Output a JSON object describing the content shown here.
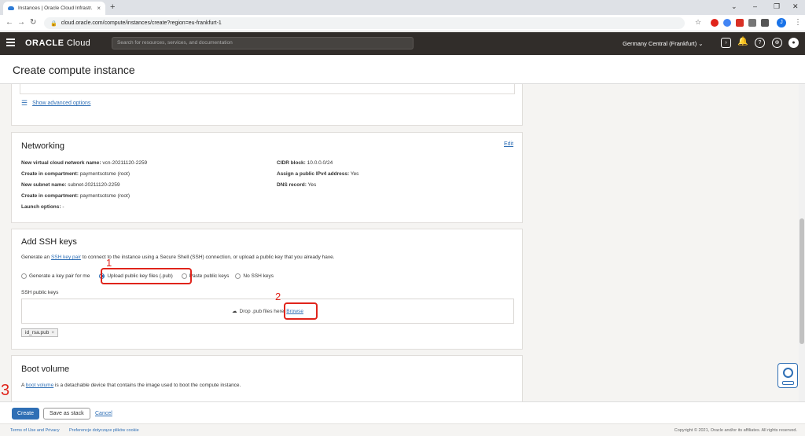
{
  "browser": {
    "tab_title": "Instances | Oracle Cloud Infrastr...",
    "url": "cloud.oracle.com/compute/instances/create?region=eu-frankfurt-1",
    "profile_initial": "J"
  },
  "header": {
    "logo_oracle": "ORACLE",
    "logo_cloud": "Cloud",
    "search_placeholder": "Search for resources, services, and documentation",
    "region": "Germany Central (Frankfurt)"
  },
  "page": {
    "title": "Create compute instance"
  },
  "advanced": {
    "label": "Show advanced options"
  },
  "networking": {
    "title": "Networking",
    "edit": "Edit",
    "left": [
      {
        "k": "New virtual cloud network name:",
        "v": "vcn-20211120-2259"
      },
      {
        "k": "Create in compartment:",
        "v": "paymentsotsme (root)"
      },
      {
        "k": "New subnet name:",
        "v": "subnet-20211120-2259"
      },
      {
        "k": "Create in compartment:",
        "v": "paymentsotsme (root)"
      },
      {
        "k": "Launch options:",
        "v": "-"
      }
    ],
    "right": [
      {
        "k": "CIDR block:",
        "v": "10.0.0.0/24"
      },
      {
        "k": "Assign a public IPv4 address:",
        "v": "Yes"
      },
      {
        "k": "DNS record:",
        "v": "Yes"
      }
    ]
  },
  "ssh": {
    "title": "Add SSH keys",
    "desc_pre": "Generate an",
    "desc_link": "SSH key pair",
    "desc_post": "to connect to the instance using a Secure Shell (SSH) connection, or upload a public key that you already have.",
    "options": [
      "Generate a key pair for me",
      "Upload public key files (.pub)",
      "Paste public keys",
      "No SSH keys"
    ],
    "selected": "Upload public key files (.pub)",
    "keys_label": "SSH public keys",
    "drop_text": "Drop .pub files here",
    "browse": "Browse",
    "file": "id_rsa.pub"
  },
  "boot": {
    "title": "Boot volume",
    "desc_pre": "A",
    "desc_link": "boot volume",
    "desc_post": "is a detachable device that contains the image used to boot the compute instance."
  },
  "annotations": {
    "n1": "1",
    "n2": "2",
    "n3": "3"
  },
  "actions": {
    "create": "Create",
    "save_stack": "Save as stack",
    "cancel": "Cancel"
  },
  "footer": {
    "terms": "Terms of Use and Privacy",
    "cookies": "Preferencje dotyczące plików cookie",
    "copyright": "Copyright © 2021, Oracle and/or its affiliates. All rights reserved."
  },
  "colors": {
    "accent": "#2f6fb5",
    "annotation_red": "#e0241b",
    "header_bg": "#312d2a"
  }
}
